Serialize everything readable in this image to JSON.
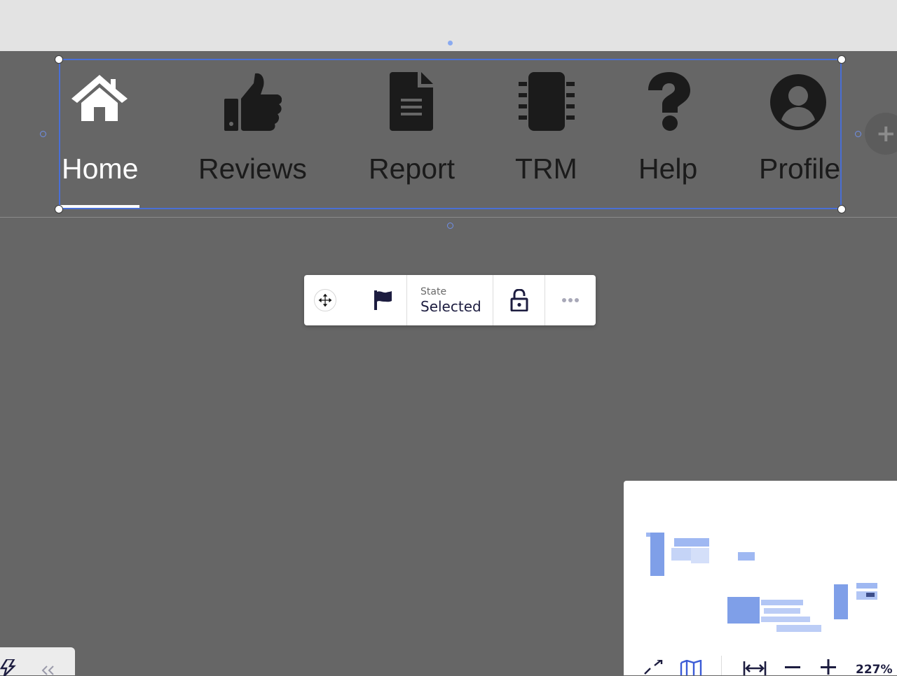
{
  "nav": {
    "items": [
      {
        "label": "Home",
        "icon": "home-icon",
        "active": true
      },
      {
        "label": "Reviews",
        "icon": "thumbs-up-icon",
        "active": false
      },
      {
        "label": "Report",
        "icon": "document-icon",
        "active": false
      },
      {
        "label": "TRM",
        "icon": "chip-icon",
        "active": false
      },
      {
        "label": "Help",
        "icon": "question-icon",
        "active": false
      },
      {
        "label": "Profile",
        "icon": "user-circle-icon",
        "active": false
      }
    ]
  },
  "toolbar": {
    "state_label": "State",
    "state_value": "Selected"
  },
  "minimap": {
    "zoom": "227%"
  },
  "colors": {
    "canvas": "#666666",
    "top_band": "#e3e3e3",
    "selection": "#4a6fd6",
    "toolbar_icon": "#1d1d40",
    "minimap_block": "#9fb8f2"
  }
}
